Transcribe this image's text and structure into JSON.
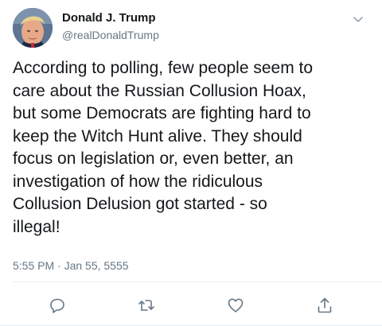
{
  "author": {
    "display_name": "Donald J. Trump",
    "handle": "@realDonaldTrump",
    "avatar_icon": "profile-photo"
  },
  "tweet": {
    "lines": [
      "According to polling, few people seem to",
      "care about the Russian Collusion Hoax,",
      "but some Democrats are fighting hard to",
      "keep the Witch Hunt alive. They should",
      "focus on legislation or, even better, an",
      "investigation of how the ridiculous",
      "Collusion Delusion got started - so",
      "illegal!"
    ],
    "timestamp": "5:55 PM · Jan 55, 5555"
  },
  "actions": {
    "reply_icon": "reply-icon",
    "retweet_icon": "retweet-icon",
    "like_icon": "heart-icon",
    "share_icon": "share-icon"
  },
  "colors": {
    "text": "#14171a",
    "secondary": "#657786",
    "icon": "#657786",
    "divider": "#e6ecf0"
  }
}
